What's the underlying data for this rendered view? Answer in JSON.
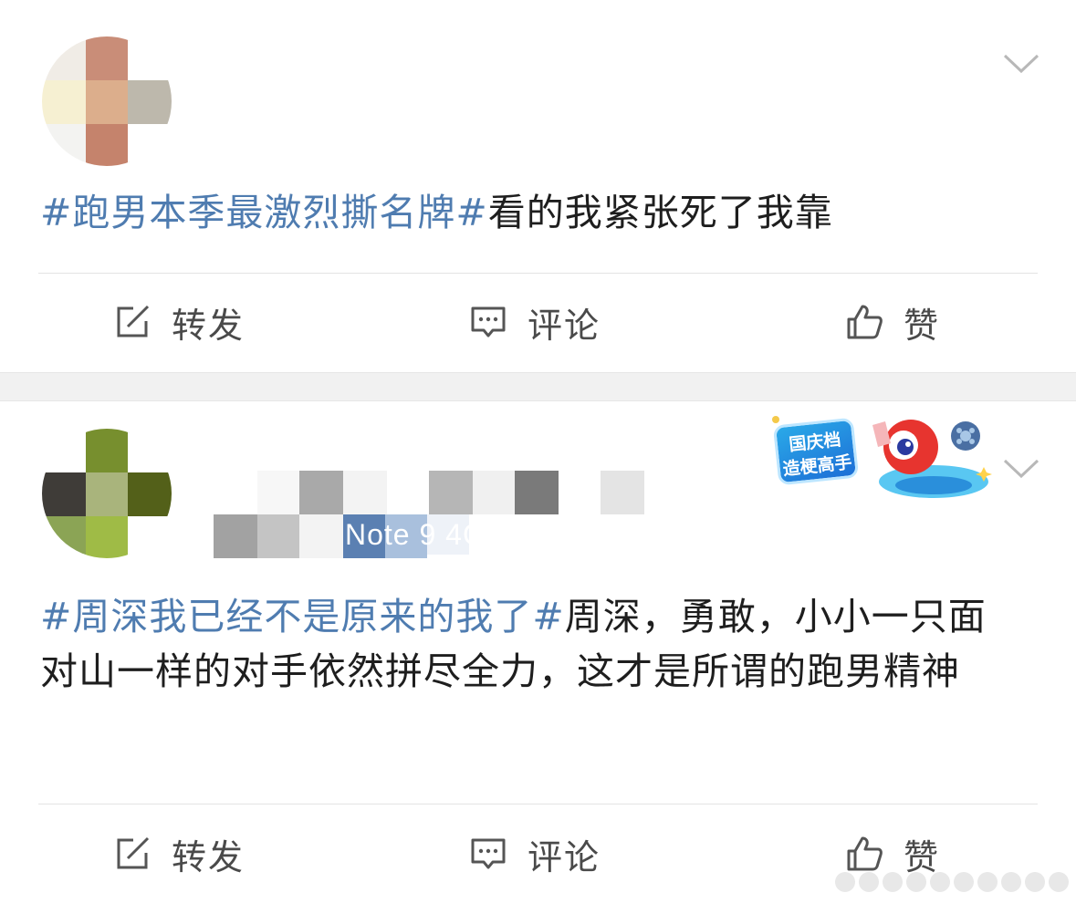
{
  "posts": [
    {
      "text_tag": "#跑男本季最激烈撕名牌#",
      "text_body": "看的我紧张死了我靠",
      "actions": {
        "repost": "转发",
        "comment": "评论",
        "like": "赞"
      }
    },
    {
      "device": "Note 9 4G",
      "text_tag": "#周深我已经不是原来的我了#",
      "text_body": "周深，勇敢，小小一只面对山一样的对手依然拼尽全力，这才是所谓的跑男精神",
      "badge": {
        "line1": "国庆档",
        "line2": "造梗高手"
      },
      "actions": {
        "repost": "转发",
        "comment": "评论",
        "like": "赞"
      }
    }
  ],
  "colors": {
    "tag": "#4f7cb0",
    "text": "#1e1e1e",
    "action": "#4a4a4a",
    "gap": "#f1f1f1"
  },
  "icons": [
    "chevron-down-icon",
    "repost-icon",
    "comment-icon",
    "like-icon"
  ]
}
